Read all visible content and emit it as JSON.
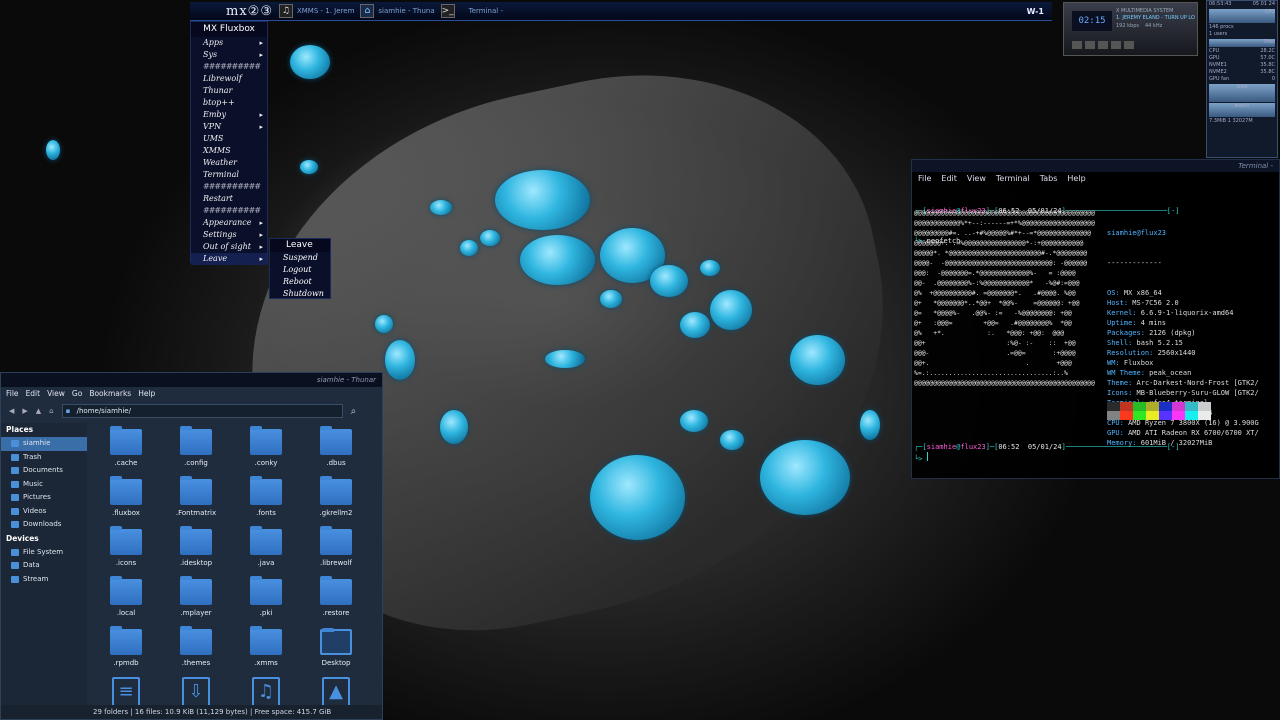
{
  "taskbar": {
    "logo": "mx②③",
    "items": [
      "XMMS - 1. Jerem",
      "siamhie - Thuna",
      "Terminal -"
    ],
    "workspace": "W-1"
  },
  "xmms": {
    "time": "02:15",
    "title": "X MULTIMEDIA SYSTEM",
    "track": "1. JEREMY ELAND - TURN UP LO",
    "kbps": "192 kbps",
    "khz": "44 kHz"
  },
  "gkrellm": {
    "clock_time": "06:53:43",
    "clock_date": "05 01 24",
    "cpu_label": "CPU",
    "procs": "146 procs",
    "users": "1 users",
    "proc_label": "Proc",
    "temps": [
      {
        "k": "CPU",
        "v": "28.2C"
      },
      {
        "k": "GPU",
        "v": "57.0C"
      },
      {
        "k": "NVME1",
        "v": "35.8C"
      },
      {
        "k": "NVME2",
        "v": "35.8C"
      },
      {
        "k": "GPU fan",
        "v": "0"
      }
    ],
    "disk_label": "Disk",
    "net_label": "wlan0",
    "mem": "7.3MiB 1 32027M"
  },
  "fluxbox_menu": {
    "title": "MX Fluxbox",
    "items": [
      {
        "label": "Apps",
        "sub": true
      },
      {
        "label": "Sys",
        "sub": true
      },
      {
        "label": "##########",
        "sep": true
      },
      {
        "label": "Librewolf"
      },
      {
        "label": "Thunar"
      },
      {
        "label": "btop++"
      },
      {
        "label": "Emby",
        "sub": true
      },
      {
        "label": "VPN",
        "sub": true
      },
      {
        "label": "UMS"
      },
      {
        "label": "XMMS"
      },
      {
        "label": "Weather"
      },
      {
        "label": "Terminal"
      },
      {
        "label": "##########",
        "sep": true
      },
      {
        "label": "Restart"
      },
      {
        "label": "##########",
        "sep": true
      },
      {
        "label": "Appearance",
        "sub": true
      },
      {
        "label": "Settings",
        "sub": true
      },
      {
        "label": "Out of sight",
        "sub": true
      },
      {
        "label": "Leave",
        "sub": true,
        "active": true
      }
    ]
  },
  "leave_menu": {
    "title": "Leave",
    "items": [
      "Suspend",
      "Logout",
      "Reboot",
      "Shutdown"
    ]
  },
  "terminal": {
    "title": "Terminal -",
    "menu": [
      "File",
      "Edit",
      "View",
      "Terminal",
      "Tabs",
      "Help"
    ],
    "prompt1": {
      "user": "siamhie",
      "host": "flux23",
      "time": "06:52",
      "date": "05/01/24"
    },
    "command": "neofetch",
    "logo": [
      "@@@@@@@@@@@@@@@@@@@@@@@@@@@@@@@@@@@@@@@@@@@@@@@",
      "@@@@@@@@@@@@%*+--:------=+*%@@@@@@@@@@@@@@@@@@@",
      "@@@@@@@@@#=. ..-+#%@@@@@%#*+--=*@@@@@@@@@@@@@@",
      "@@@@@@@+. .=%@@@@@@@@@@@@@@@@*-:+@@@@@@@@@@@",
      "@@@@@*. *@@@@@@@@@@@@@@@@@@@@@@@@#-.*@@@@@@@@",
      "@@@@-  -@@@@@@@@@@@@@@@@@@@@@@@@@@@@: -@@@@@@",
      "@@@:  -@@@@@@@=.*@@@@@@@@@@@@@%-   = :@@@@",
      "@@-  .@@@@@@@@%-:%@@@@@@@@@@@@*   -%@#:=@@@",
      "@%  +@@@@@@@@@@#. =@@@@@@@*.   .#@@@@. %@@",
      "@+   *@@@@@@@*..*@@+  *@@%-    =@@@@@@: +@@",
      "@=   *@@@@%-   .@@%- :=   -%@@@@@@@@: +@@",
      "@+   :@@@=        +@@=   .#@@@@@@@@%  *@@",
      "@%   +*.           :.   *@@@: +@@:  @@@",
      "@@+                     :%@- :-    ::  +@@",
      "@@@-                    .=@@=       :+@@@@",
      "@@+.                         .       +@@@",
      "%=.:................................:..%",
      "@@@@@@@@@@@@@@@@@@@@@@@@@@@@@@@@@@@@@@@@@@@@@@@"
    ],
    "info_header": "siamhie@flux23",
    "info_sep": "-------------",
    "info": [
      {
        "k": "OS",
        "v": "MX x86_64"
      },
      {
        "k": "Host",
        "v": "MS-7C56 2.0"
      },
      {
        "k": "Kernel",
        "v": "6.6.9-1-liquorix-amd64"
      },
      {
        "k": "Uptime",
        "v": "4 mins"
      },
      {
        "k": "Packages",
        "v": "2126 (dpkg)"
      },
      {
        "k": "Shell",
        "v": "bash 5.2.15"
      },
      {
        "k": "Resolution",
        "v": "2560x1440"
      },
      {
        "k": "WM",
        "v": "Fluxbox"
      },
      {
        "k": "WM Theme",
        "v": "peak_ocean"
      },
      {
        "k": "Theme",
        "v": "Arc-Darkest-Nord-Frost [GTK2/"
      },
      {
        "k": "Icons",
        "v": "MB-Blueberry-Suru-GLOW [GTK2/"
      },
      {
        "k": "Terminal",
        "v": "xfce4-terminal"
      },
      {
        "k": "Terminal Font",
        "v": "monofur 14"
      },
      {
        "k": "CPU",
        "v": "AMD Ryzen 7 3800X (16) @ 3.900G"
      },
      {
        "k": "GPU",
        "v": "AMD ATI Radeon RX 6700/6700 XT/"
      },
      {
        "k": "Memory",
        "v": "601MiB / 32027MiB"
      }
    ],
    "colors": [
      "#2a2a2a",
      "#c23621",
      "#25bc24",
      "#adad27",
      "#1a2fc4",
      "#d338d3",
      "#33bbc8",
      "#cbcccd",
      "#818383",
      "#fc391f",
      "#31e722",
      "#eaec23",
      "#5833ff",
      "#f935f8",
      "#14f0f0",
      "#e9ebeb"
    ],
    "prompt2": {
      "user": "siamhie",
      "host": "flux23",
      "time": "06:52",
      "date": "05/01/24"
    }
  },
  "thunar": {
    "title": "siamhie - Thunar",
    "menu": [
      "File",
      "Edit",
      "View",
      "Go",
      "Bookmarks",
      "Help"
    ],
    "path": "/home/siamhie/",
    "places_header": "Places",
    "places": [
      "siamhie",
      "Trash",
      "Documents",
      "Music",
      "Pictures",
      "Videos",
      "Downloads"
    ],
    "devices_header": "Devices",
    "devices": [
      "File System",
      "Data",
      "Stream"
    ],
    "files": [
      ".cache",
      ".config",
      ".conky",
      ".dbus",
      ".fluxbox",
      ".Fontmatrix",
      ".fonts",
      ".gkrellm2",
      ".icons",
      ".idesktop",
      ".java",
      ".librewolf",
      ".local",
      ".mplayer",
      ".pki",
      ".restore",
      ".rpmdb",
      ".themes",
      ".xmms",
      "Desktop",
      "",
      "",
      "",
      ""
    ],
    "status": "29 folders  |  16 files: 10.9 KiB (11,129 bytes)  |  Free space: 415.7 GiB"
  }
}
